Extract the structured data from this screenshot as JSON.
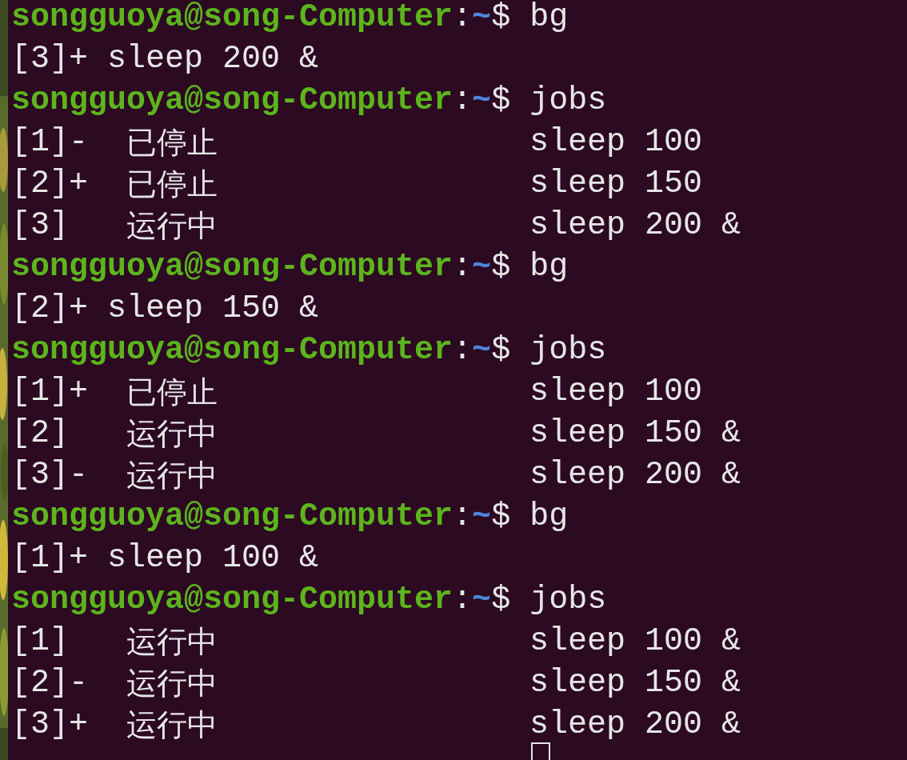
{
  "terminal": {
    "lines": [
      {
        "kind": "prompt",
        "user": "songguoya@song-Computer",
        "separator": ":",
        "path": "~",
        "symbol": "$",
        "command": "bg"
      },
      {
        "kind": "output",
        "text": "[3]+ sleep 200 &"
      },
      {
        "kind": "prompt",
        "user": "songguoya@song-Computer",
        "separator": ":",
        "path": "~",
        "symbol": "$",
        "command": "jobs"
      },
      {
        "kind": "job",
        "id": "[1]-",
        "status": "已停止",
        "command": "sleep 100"
      },
      {
        "kind": "job",
        "id": "[2]+",
        "status": "已停止",
        "command": "sleep 150"
      },
      {
        "kind": "job",
        "id": "[3]",
        "status": "运行中",
        "command": "sleep 200 &"
      },
      {
        "kind": "prompt",
        "user": "songguoya@song-Computer",
        "separator": ":",
        "path": "~",
        "symbol": "$",
        "command": "bg"
      },
      {
        "kind": "output",
        "text": "[2]+ sleep 150 &"
      },
      {
        "kind": "prompt",
        "user": "songguoya@song-Computer",
        "separator": ":",
        "path": "~",
        "symbol": "$",
        "command": "jobs"
      },
      {
        "kind": "job",
        "id": "[1]+",
        "status": "已停止",
        "command": "sleep 100"
      },
      {
        "kind": "job",
        "id": "[2]",
        "status": "运行中",
        "command": "sleep 150 &"
      },
      {
        "kind": "job",
        "id": "[3]-",
        "status": "运行中",
        "command": "sleep 200 &"
      },
      {
        "kind": "prompt",
        "user": "songguoya@song-Computer",
        "separator": ":",
        "path": "~",
        "symbol": "$",
        "command": "bg"
      },
      {
        "kind": "output",
        "text": "[1]+ sleep 100 &"
      },
      {
        "kind": "prompt",
        "user": "songguoya@song-Computer",
        "separator": ":",
        "path": "~",
        "symbol": "$",
        "command": "jobs"
      },
      {
        "kind": "job",
        "id": "[1]",
        "status": "运行中",
        "command": "sleep 100 &"
      },
      {
        "kind": "job",
        "id": "[2]-",
        "status": "运行中",
        "command": "sleep 150 &"
      },
      {
        "kind": "job",
        "id": "[3]+",
        "status": "运行中",
        "command": "sleep 200 &"
      }
    ]
  }
}
